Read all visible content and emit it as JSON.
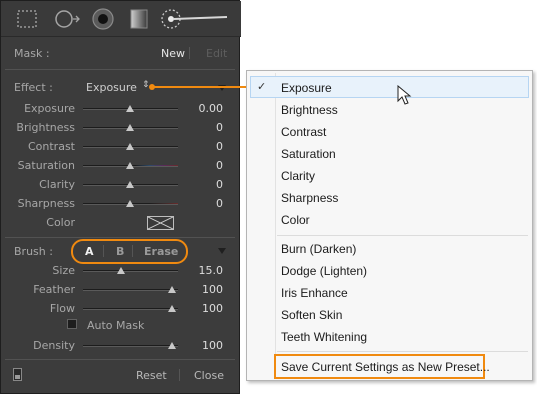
{
  "mask": {
    "label": "Mask :",
    "new_label": "New",
    "edit_label": "Edit"
  },
  "effect": {
    "label": "Effect :",
    "selected": "Exposure",
    "sliders": [
      {
        "label": "Exposure",
        "value": "0.00",
        "level": 0.5
      },
      {
        "label": "Brightness",
        "value": "0",
        "level": 0.5
      },
      {
        "label": "Contrast",
        "value": "0",
        "level": 0.5
      },
      {
        "label": "Saturation",
        "value": "0",
        "level": 0.5
      },
      {
        "label": "Clarity",
        "value": "0",
        "level": 0.5
      },
      {
        "label": "Sharpness",
        "value": "0",
        "level": 0.5
      }
    ],
    "color_label": "Color"
  },
  "brush": {
    "label": "Brush :",
    "tabs": [
      "A",
      "B",
      "Erase"
    ],
    "sliders": [
      {
        "label": "Size",
        "value": "15.0",
        "level": 0.4
      },
      {
        "label": "Feather",
        "value": "100",
        "level": 1.0
      },
      {
        "label": "Flow",
        "value": "100",
        "level": 1.0
      }
    ],
    "auto_mask_label": "Auto Mask",
    "density": {
      "label": "Density",
      "value": "100",
      "level": 1.0
    }
  },
  "footer": {
    "reset_label": "Reset",
    "close_label": "Close"
  },
  "menu": {
    "groups": [
      [
        "Exposure",
        "Brightness",
        "Contrast",
        "Saturation",
        "Clarity",
        "Sharpness",
        "Color"
      ],
      [
        "Burn (Darken)",
        "Dodge (Lighten)",
        "Iris Enhance",
        "Soften Skin",
        "Teeth Whitening"
      ]
    ],
    "save_preset": "Save Current Settings as New Preset...",
    "checked_item": "Exposure"
  },
  "colors": {
    "panel_bg": "#3c3c3c",
    "annotation": "#f08a10",
    "menu_highlight": "#e8f2fb"
  },
  "icons": [
    "marquee-tool-icon",
    "spot-removal-tool-icon",
    "red-eye-tool-icon",
    "graduated-filter-icon",
    "adjustment-brush-icon"
  ]
}
